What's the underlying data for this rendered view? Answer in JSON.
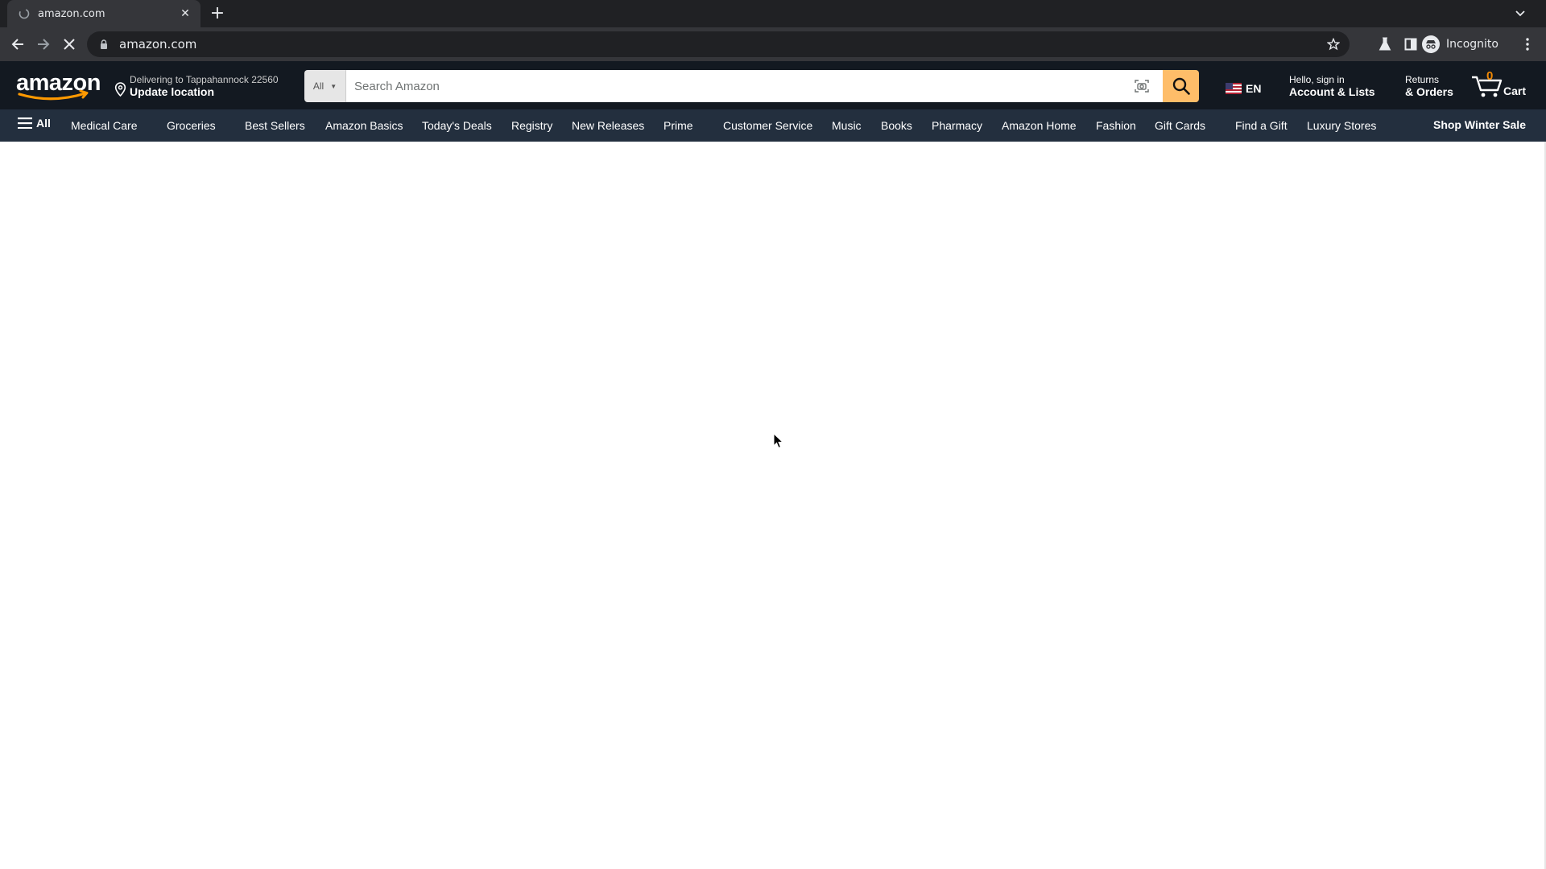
{
  "browser": {
    "tab_title": "amazon.com",
    "new_tab_symbol": "+",
    "url": "amazon.com",
    "profile_label": "Incognito"
  },
  "header": {
    "deliver_line1": "Delivering to Tappahannock 22560",
    "deliver_line2": "Update location",
    "search_dept": "All",
    "search_placeholder": "Search Amazon",
    "language": "EN",
    "account_line1": "Hello, sign in",
    "account_line2": "Account & Lists",
    "returns_line1": "Returns",
    "returns_line2": "& Orders",
    "cart_count": "0",
    "cart_label": "Cart"
  },
  "nav": {
    "all_label": "All",
    "items": [
      "Medical Care",
      "Groceries",
      "Best Sellers",
      "Amazon Basics",
      "Today's Deals",
      "Registry",
      "New Releases",
      "Prime",
      "Customer Service",
      "Music",
      "Books",
      "Pharmacy",
      "Amazon Home",
      "Fashion",
      "Gift Cards",
      "Find a Gift",
      "Luxury Stores"
    ],
    "promo": "Shop Winter Sale"
  },
  "colors": {
    "nav_belt": "#131921",
    "nav_main": "#232f3e",
    "search_button": "#febd69",
    "cart_count": "#f08804"
  },
  "icons": [
    "favicon-icon",
    "close-icon",
    "plus-icon",
    "chevron-down-icon",
    "back-arrow-icon",
    "forward-arrow-icon",
    "stop-icon",
    "lock-icon",
    "star-icon",
    "labs-icon",
    "side-panel-icon",
    "incognito-icon",
    "kebab-icon",
    "location-pin-icon",
    "camera-icon",
    "search-icon",
    "us-flag-icon",
    "cart-icon",
    "hamburger-icon",
    "mouse-pointer-icon"
  ]
}
